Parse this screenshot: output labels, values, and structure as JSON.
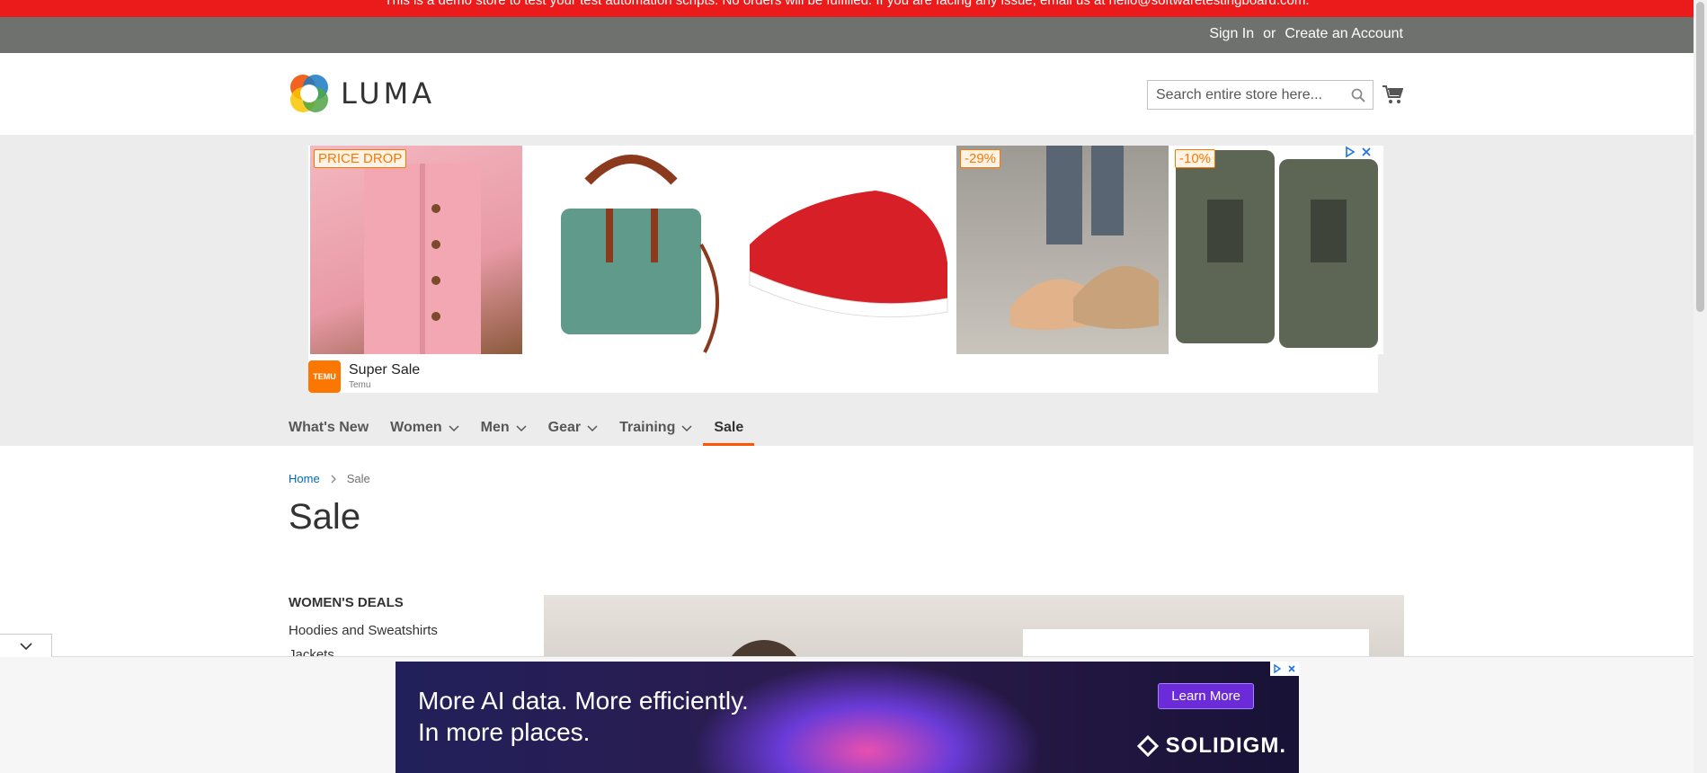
{
  "demo_notice": "This is a demo store to test your test automation scripts. No orders will be fulfilled. If you are facing any issue, email us at hello@softwaretestingboard.com.",
  "header": {
    "sign_in": "Sign In",
    "or": "or",
    "create_account": "Create an Account",
    "logo_text": "LUMA",
    "search_placeholder": "Search entire store here...",
    "colors": {
      "panel": "#6e716e",
      "demo_bar": "#ec1b1b"
    }
  },
  "ad": {
    "tags": [
      "PRICE DROP",
      "-29%",
      "-10%"
    ],
    "brand_title": "Super Sale",
    "brand_sub": "Temu",
    "brand_logo": "TEMU",
    "accent": "#fb7701"
  },
  "nav": {
    "items": [
      {
        "label": "What's New",
        "has_menu": false
      },
      {
        "label": "Women",
        "has_menu": true
      },
      {
        "label": "Men",
        "has_menu": true
      },
      {
        "label": "Gear",
        "has_menu": true
      },
      {
        "label": "Training",
        "has_menu": true
      },
      {
        "label": "Sale",
        "has_menu": false,
        "active": true
      }
    ],
    "accent": "#ff5501"
  },
  "breadcrumb": {
    "home": "Home",
    "current": "Sale"
  },
  "page_title": "Sale",
  "sidebar": {
    "heading": "WOMEN'S DEALS",
    "links": [
      "Hoodies and Sweatshirts",
      "Jackets"
    ]
  },
  "bottom_ad": {
    "line1": "More AI data. More efficiently.",
    "line2": "In more places.",
    "cta": "Learn More",
    "brand": "SOLIDIGM."
  }
}
